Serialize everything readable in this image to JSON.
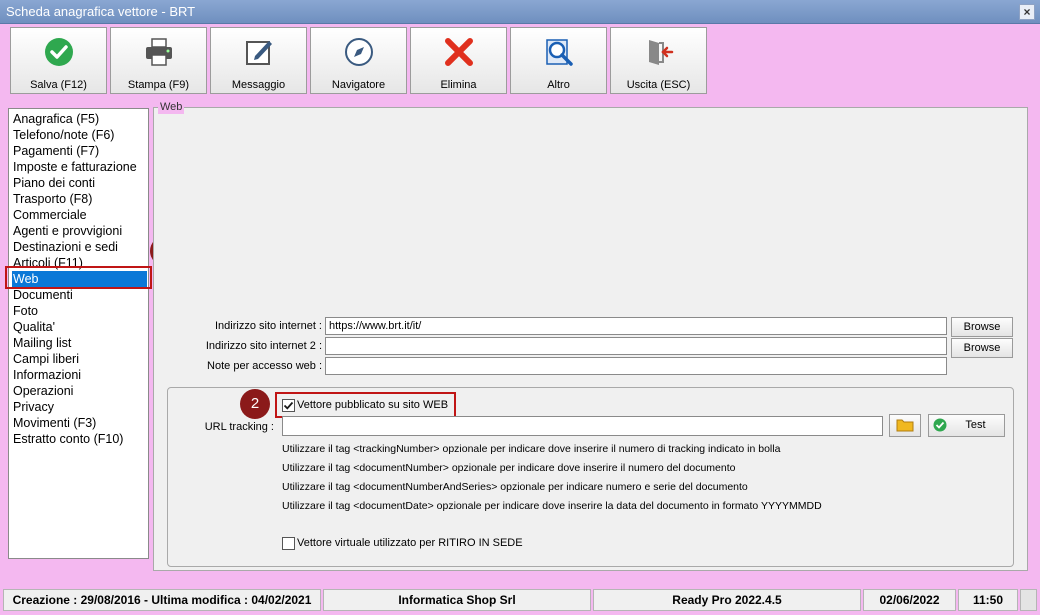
{
  "window": {
    "title": "Scheda anagrafica vettore - BRT",
    "close_glyph": "×"
  },
  "toolbar": [
    {
      "label": "Salva (F12)",
      "icon": "check-circle-icon",
      "color": "#2fa84f"
    },
    {
      "label": "Stampa (F9)",
      "icon": "printer-icon",
      "color": "#555555"
    },
    {
      "label": "Messaggio",
      "icon": "message-edit-icon",
      "color": "#555555"
    },
    {
      "label": "Navigatore",
      "icon": "compass-icon",
      "color": "#3a5a80"
    },
    {
      "label": "Elimina",
      "icon": "delete-x-icon",
      "color": "#e0301e"
    },
    {
      "label": "Altro",
      "icon": "magnifier-icon",
      "color": "#1a5fb4"
    },
    {
      "label": "Uscita (ESC)",
      "icon": "exit-door-icon",
      "color": "#d0301e"
    }
  ],
  "nav": {
    "items": [
      "Anagrafica (F5)",
      "Telefono/note (F6)",
      "Pagamenti (F7)",
      "Imposte e fatturazione",
      "Piano dei conti",
      "Trasporto (F8)",
      "Commerciale",
      "Agenti e provvigioni",
      "Destinazioni e sedi",
      "Articoli (F11)",
      "Web",
      "Documenti",
      "Foto",
      "Qualita'",
      "Mailing list",
      "Campi liberi",
      "Informazioni",
      "Operazioni",
      "Privacy",
      "Movimenti (F3)",
      "Estratto conto (F10)"
    ],
    "selected_index": 10
  },
  "annotations": {
    "badge1": "1",
    "badge2": "2",
    "color": "#8b1a1a"
  },
  "web": {
    "panel_title": "Web",
    "site_label": "Indirizzo sito internet :",
    "site_value": "https://www.brt.it/it/",
    "site2_label": "Indirizzo sito internet 2 :",
    "site2_value": "",
    "notes_label": "Note per accesso web :",
    "notes_value": "",
    "browse_label": "Browse",
    "published_label": "Vettore pubblicato su sito WEB",
    "published_checked": true,
    "url_tracking_label": "URL tracking :",
    "url_tracking_value": "",
    "test_label": "Test",
    "info_lines": [
      "Utilizzare il tag <trackingNumber> opzionale per indicare dove inserire il numero di tracking indicato in bolla",
      "Utilizzare il tag <documentNumber> opzionale per indicare dove inserire il numero del documento",
      "Utilizzare il tag <documentNumberAndSeries> opzionale per indicare numero e serie del documento",
      "Utilizzare il tag <documentDate> opzionale per indicare dove inserire la data del documento in formato YYYYMMDD"
    ],
    "virtual_label": "Vettore virtuale utilizzato per RITIRO IN SEDE",
    "virtual_checked": false
  },
  "statusbar": {
    "dates": "Creazione : 29/08/2016 - Ultima modifica : 04/02/2021",
    "company": "Informatica Shop Srl",
    "version": "Ready Pro 2022.4.5",
    "date": "02/06/2022",
    "time": "11:50"
  }
}
